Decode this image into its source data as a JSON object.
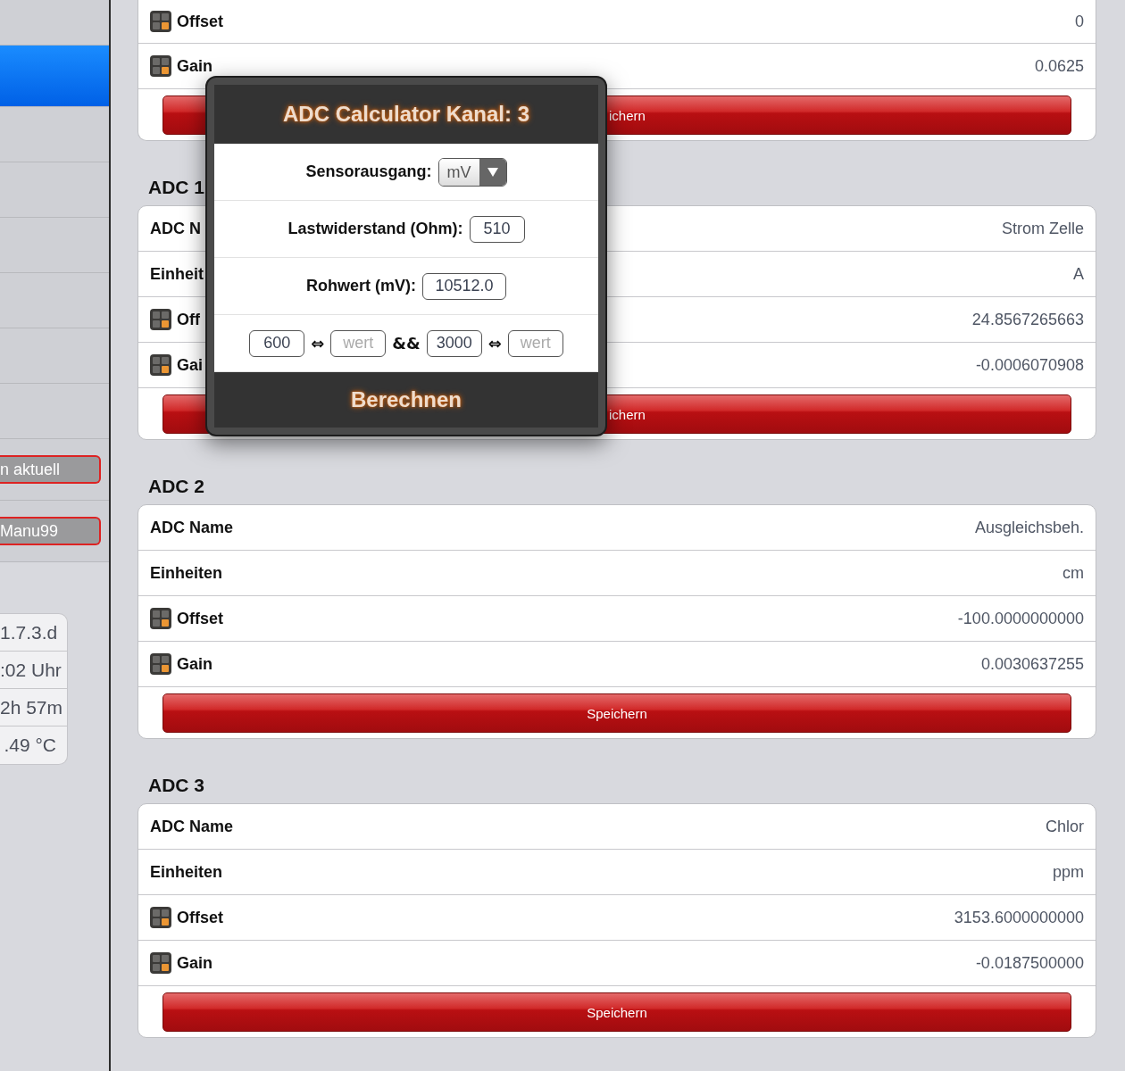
{
  "sidebar": {
    "items": [
      {
        "selected": false
      },
      {
        "selected": true
      },
      {
        "selected": false
      },
      {
        "selected": false
      },
      {
        "selected": false
      },
      {
        "selected": false
      },
      {
        "selected": false
      },
      {
        "selected": false
      }
    ],
    "buttons": [
      "n aktuell",
      "Manu99"
    ],
    "info": [
      "1.7.3.d",
      ":02 Uhr",
      "2h 57m",
      ".49 °C"
    ]
  },
  "sections": [
    {
      "rows": [
        {
          "kind": "calc",
          "label": "Offset",
          "value": "0"
        },
        {
          "kind": "calc",
          "label": "Gain",
          "value": "0.0625"
        }
      ],
      "button": {
        "label": "ichern",
        "covered": true
      }
    },
    {
      "heading": "ADC 1",
      "rows": [
        {
          "kind": "text",
          "label": "ADC N",
          "value": "Strom Zelle"
        },
        {
          "kind": "text",
          "label": "Einheit",
          "value": "A"
        },
        {
          "kind": "calc",
          "label": "Off",
          "value": "24.8567265663"
        },
        {
          "kind": "calc",
          "label": "Gai",
          "value": "-0.0006070908"
        }
      ],
      "button": {
        "label": "ichern",
        "covered": true
      }
    },
    {
      "heading": "ADC 2",
      "rows": [
        {
          "kind": "text",
          "label": "ADC Name",
          "value": "Ausgleichsbeh."
        },
        {
          "kind": "text",
          "label": "Einheiten",
          "value": "cm"
        },
        {
          "kind": "calc",
          "label": "Offset",
          "value": "-100.0000000000"
        },
        {
          "kind": "calc",
          "label": "Gain",
          "value": "0.0030637255"
        }
      ],
      "button": {
        "label": "Speichern",
        "covered": false
      }
    },
    {
      "heading": "ADC 3",
      "rows": [
        {
          "kind": "text",
          "label": "ADC Name",
          "value": "Chlor"
        },
        {
          "kind": "text",
          "label": "Einheiten",
          "value": "ppm"
        },
        {
          "kind": "calc",
          "label": "Offset",
          "value": "3153.6000000000"
        },
        {
          "kind": "calc",
          "label": "Gain",
          "value": "-0.0187500000"
        }
      ],
      "button": {
        "label": "Speichern",
        "covered": false
      }
    }
  ],
  "dialog": {
    "title": "ADC Calculator Kanal: 3",
    "fields": [
      {
        "kind": "select",
        "label": "Sensorausgang:",
        "value": "mV"
      },
      {
        "kind": "input",
        "label": "Lastwiderstand (Ohm):",
        "value": "510"
      },
      {
        "kind": "input",
        "label": "Rohwert (mV):",
        "value": "10512.0"
      }
    ],
    "mapping": [
      {
        "kind": "input",
        "value": "600"
      },
      {
        "kind": "symbol",
        "text": "⇔"
      },
      {
        "kind": "input",
        "placeholder": "wert"
      },
      {
        "kind": "symbol",
        "text": "&&"
      },
      {
        "kind": "input",
        "value": "3000"
      },
      {
        "kind": "symbol",
        "text": "⇔"
      },
      {
        "kind": "input",
        "placeholder": "wert"
      }
    ],
    "action": "Berechnen"
  }
}
